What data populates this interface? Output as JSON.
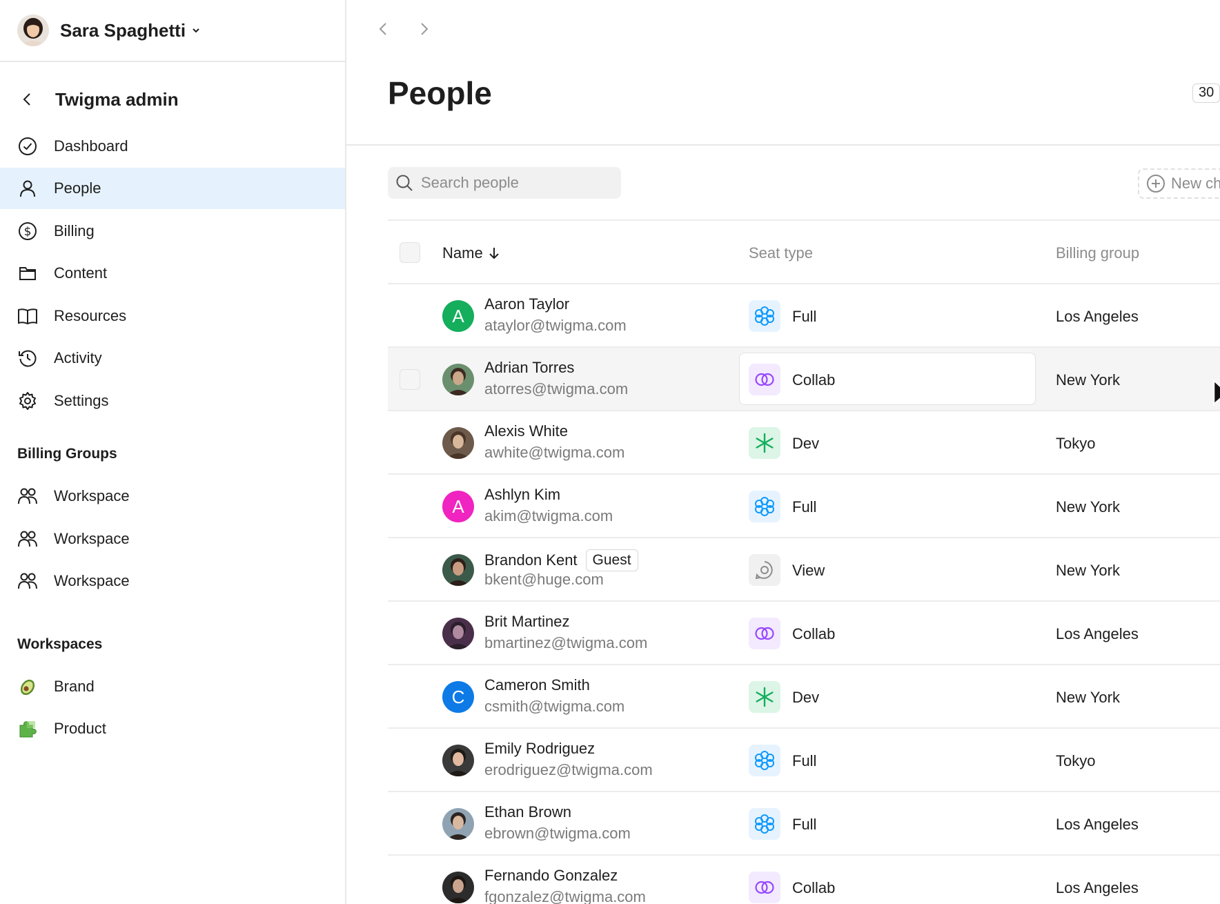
{
  "user": {
    "name": "Sara Spaghetti"
  },
  "admin": {
    "title": "Twigma admin"
  },
  "nav": [
    {
      "label": "Dashboard",
      "icon": "check-circle-icon"
    },
    {
      "label": "People",
      "icon": "person-icon",
      "active": true
    },
    {
      "label": "Billing",
      "icon": "dollar-circle-icon"
    },
    {
      "label": "Content",
      "icon": "folder-icon"
    },
    {
      "label": "Resources",
      "icon": "book-icon"
    },
    {
      "label": "Activity",
      "icon": "history-icon"
    },
    {
      "label": "Settings",
      "icon": "gear-icon"
    }
  ],
  "billing_groups": {
    "heading": "Billing Groups",
    "items": [
      {
        "label": "Workspace",
        "icon": "group-icon"
      },
      {
        "label": "Workspace",
        "icon": "group-icon"
      },
      {
        "label": "Workspace",
        "icon": "group-icon"
      }
    ]
  },
  "workspaces": {
    "heading": "Workspaces",
    "items": [
      {
        "label": "Brand",
        "icon": "avocado-icon"
      },
      {
        "label": "Product",
        "icon": "puzzle-icon"
      }
    ]
  },
  "page": {
    "title": "People",
    "count": "30"
  },
  "search": {
    "placeholder": "Search people"
  },
  "new_button": {
    "label": "New ch"
  },
  "table": {
    "columns": {
      "name": "Name",
      "seat": "Seat type",
      "billing": "Billing group"
    },
    "rows": [
      {
        "name": "Aaron Taylor",
        "email": "ataylor@twigma.com",
        "avatar_letter": "A",
        "avatar_color": "#14ae5c",
        "seat": "Full",
        "billing": "Los Angeles"
      },
      {
        "name": "Adrian Torres",
        "email": "atorres@twigma.com",
        "avatar_photo": true,
        "seat": "Collab",
        "billing": "New York",
        "hovered": true
      },
      {
        "name": "Alexis White",
        "email": "awhite@twigma.com",
        "avatar_photo": true,
        "seat": "Dev",
        "billing": "Tokyo"
      },
      {
        "name": "Ashlyn Kim",
        "email": "akim@twigma.com",
        "avatar_letter": "A",
        "avatar_color": "#f024c0",
        "seat": "Full",
        "billing": "New York"
      },
      {
        "name": "Brandon Kent",
        "email": "bkent@huge.com",
        "avatar_photo": true,
        "tag": "Guest",
        "seat": "View",
        "billing": "New York"
      },
      {
        "name": "Brit Martinez",
        "email": "bmartinez@twigma.com",
        "avatar_photo": true,
        "seat": "Collab",
        "billing": "Los Angeles"
      },
      {
        "name": "Cameron Smith",
        "email": "csmith@twigma.com",
        "avatar_letter": "C",
        "avatar_color": "#0d7ae6",
        "seat": "Dev",
        "billing": "New York"
      },
      {
        "name": "Emily Rodriguez",
        "email": "erodriguez@twigma.com",
        "avatar_photo": true,
        "seat": "Full",
        "billing": "Tokyo"
      },
      {
        "name": "Ethan Brown",
        "email": "ebrown@twigma.com",
        "avatar_photo": true,
        "seat": "Full",
        "billing": "Los Angeles"
      },
      {
        "name": "Fernando Gonzalez",
        "email": "fgonzalez@twigma.com",
        "avatar_photo": true,
        "seat": "Collab",
        "billing": "Los Angeles"
      }
    ]
  },
  "colors": {
    "active_nav_bg": "#e5f2fd",
    "full_seat": "#0d99ff",
    "collab_seat": "#9747ff",
    "dev_seat": "#14ae5c",
    "view_seat": "#8c8c8c"
  }
}
